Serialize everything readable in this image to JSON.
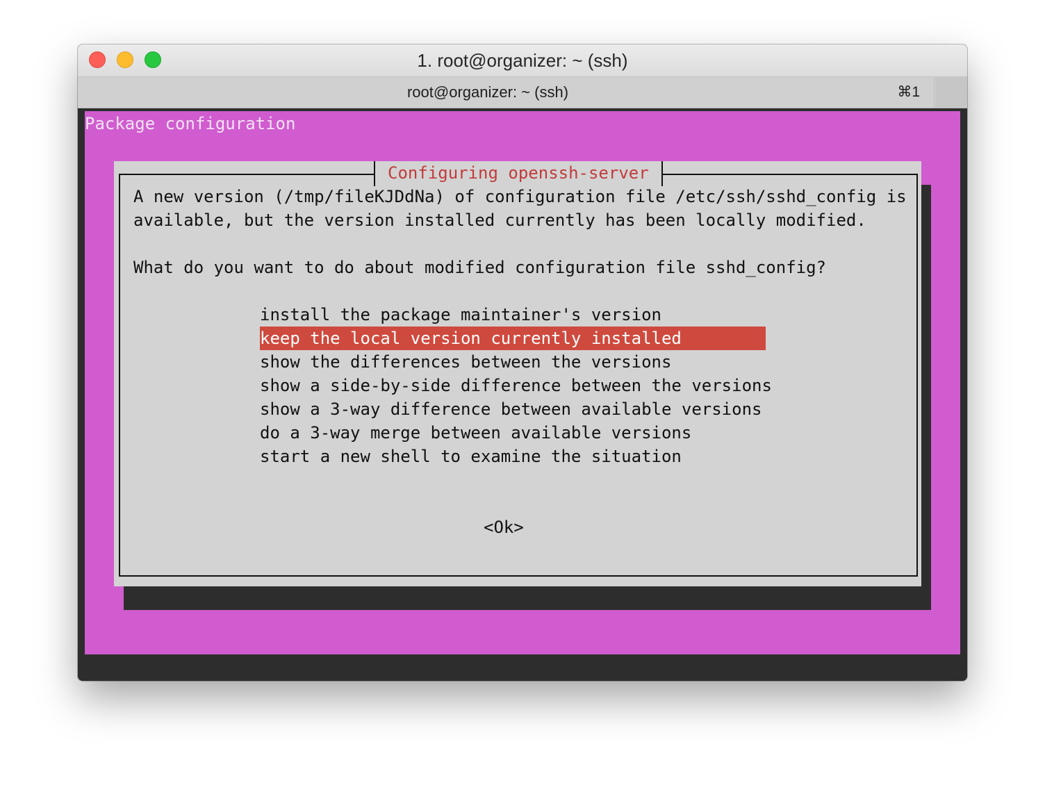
{
  "window": {
    "title": "1. root@organizer: ~ (ssh)",
    "tab_title": "root@organizer: ~ (ssh)",
    "tab_shortcut": "⌘1"
  },
  "terminal": {
    "background_color": "#d05ccf",
    "package_title": "Package configuration",
    "dialog": {
      "title": "Configuring openssh-server",
      "message_lines": [
        "A new version (/tmp/fileKJDdNa) of configuration file /etc/ssh/sshd_config is",
        "available, but the version installed currently has been locally modified.",
        "What do you want to do about modified configuration file sshd_config?"
      ],
      "options": [
        "install the package maintainer's version",
        "keep the local version currently installed",
        "show the differences between the versions",
        "show a side-by-side difference between the versions",
        "show a 3-way difference between available versions",
        "do a 3-way merge between available versions",
        "start a new shell to examine the situation"
      ],
      "selected_option": "keep the local version currently installed",
      "ok_label": "<Ok>",
      "highlight_color": "#cf4a3e",
      "title_color": "#c23b3b"
    }
  }
}
